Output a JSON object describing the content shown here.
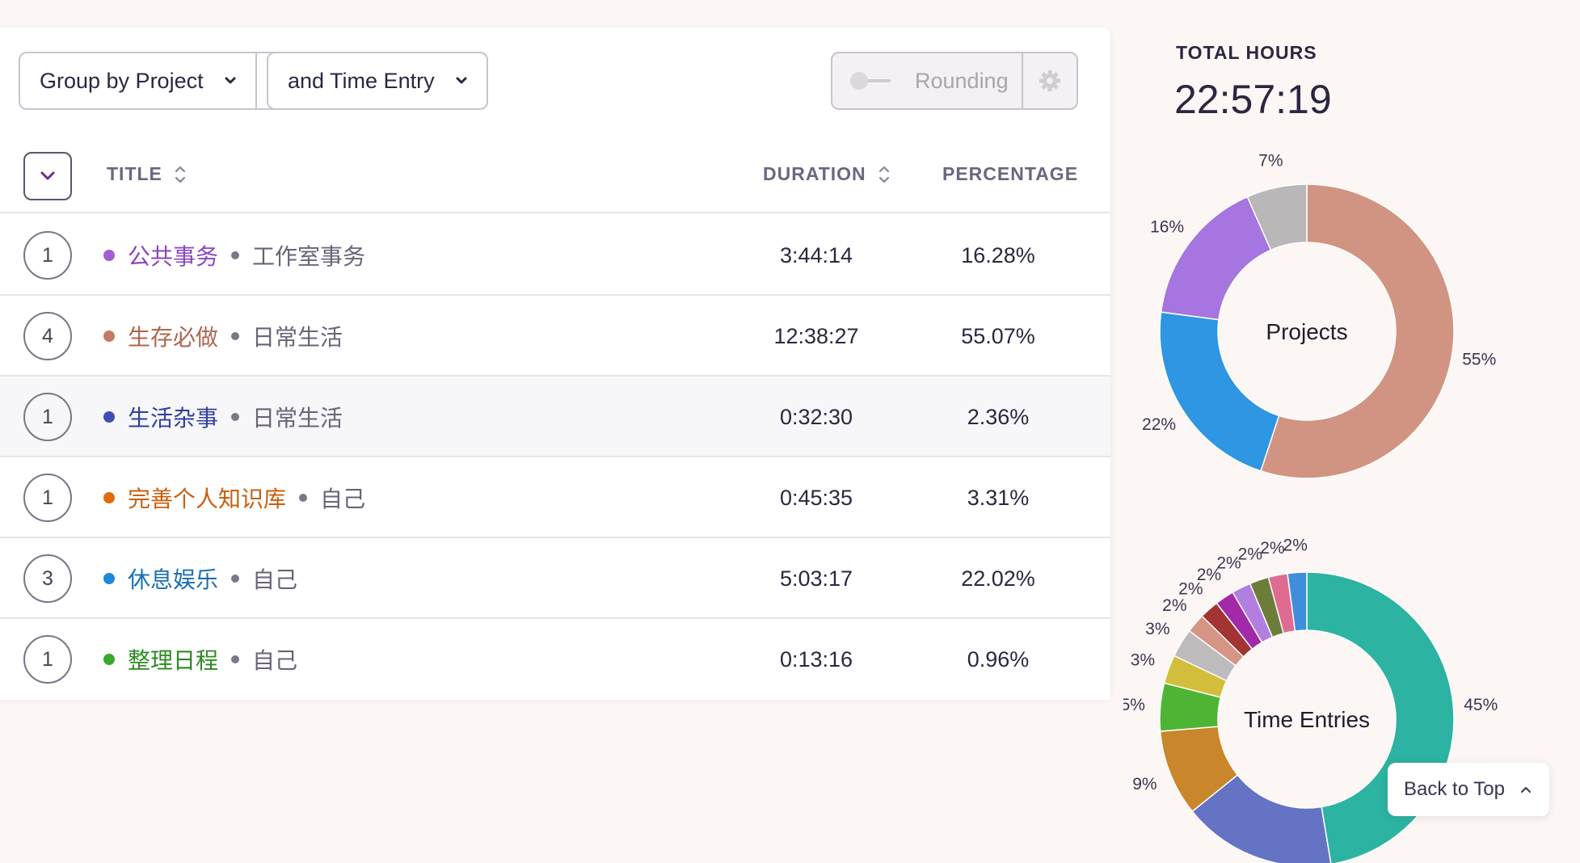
{
  "toolbar": {
    "group_by": "Group by Project",
    "sub_group": "and Time Entry",
    "rounding_label": "Rounding"
  },
  "table": {
    "headers": {
      "title": "TITLE",
      "duration": "DURATION",
      "percentage": "PERCENTAGE"
    },
    "rows": [
      {
        "count": "1",
        "project": "公共事务",
        "client": "工作室事务",
        "color": "#a35ed6",
        "duration": "3:44:14",
        "percentage": "16.28%"
      },
      {
        "count": "4",
        "project": "生存必做",
        "client": "日常生活",
        "color": "#c47a63",
        "duration": "12:38:27",
        "percentage": "55.07%"
      },
      {
        "count": "1",
        "project": "生活杂事",
        "client": "日常生活",
        "color": "#3d4fb5",
        "duration": "0:32:30",
        "percentage": "2.36%"
      },
      {
        "count": "1",
        "project": "完善个人知识库",
        "client": "自己",
        "color": "#e06b0f",
        "duration": "0:45:35",
        "percentage": "3.31%"
      },
      {
        "count": "3",
        "project": "休息娱乐",
        "client": "自己",
        "color": "#1e88d8",
        "duration": "5:03:17",
        "percentage": "22.02%"
      },
      {
        "count": "1",
        "project": "整理日程",
        "client": "自己",
        "color": "#3aa82c",
        "duration": "0:13:16",
        "percentage": "0.96%"
      }
    ]
  },
  "summary": {
    "total_label": "TOTAL HOURS",
    "total_value": "22:57:19"
  },
  "chart_data": [
    {
      "type": "pie",
      "title": "Projects",
      "donut": true,
      "slices": [
        {
          "label": "55%",
          "value": 55.07,
          "color": "#d29482"
        },
        {
          "label": "22%",
          "value": 22.02,
          "color": "#2e96e2"
        },
        {
          "label": "16%",
          "value": 16.28,
          "color": "#a675e0"
        },
        {
          "label": "7%",
          "value": 6.63,
          "color": "#b9b7b8"
        }
      ]
    },
    {
      "type": "pie",
      "title": "Time Entries",
      "donut": true,
      "slices": [
        {
          "label": "45%",
          "value": 45,
          "color": "#2db3a2"
        },
        {
          "label": "",
          "value": 16,
          "color": "#6473c4"
        },
        {
          "label": "9%",
          "value": 9,
          "color": "#c9862a"
        },
        {
          "label": "5%",
          "value": 5,
          "color": "#4db533"
        },
        {
          "label": "3%",
          "value": 3,
          "color": "#d3be3c"
        },
        {
          "label": "3%",
          "value": 3,
          "color": "#bdbbbc"
        },
        {
          "label": "2%",
          "value": 2,
          "color": "#d59484"
        },
        {
          "label": "2%",
          "value": 2,
          "color": "#a33431"
        },
        {
          "label": "2%",
          "value": 2,
          "color": "#a229a8"
        },
        {
          "label": "2%",
          "value": 2,
          "color": "#b27ee0"
        },
        {
          "label": "2%",
          "value": 2,
          "color": "#6c7d3a"
        },
        {
          "label": "2%",
          "value": 2,
          "color": "#df6b93"
        },
        {
          "label": "2%",
          "value": 2,
          "color": "#3f8edb"
        }
      ]
    }
  ],
  "footer": {
    "back_to_top": "Back to Top"
  }
}
